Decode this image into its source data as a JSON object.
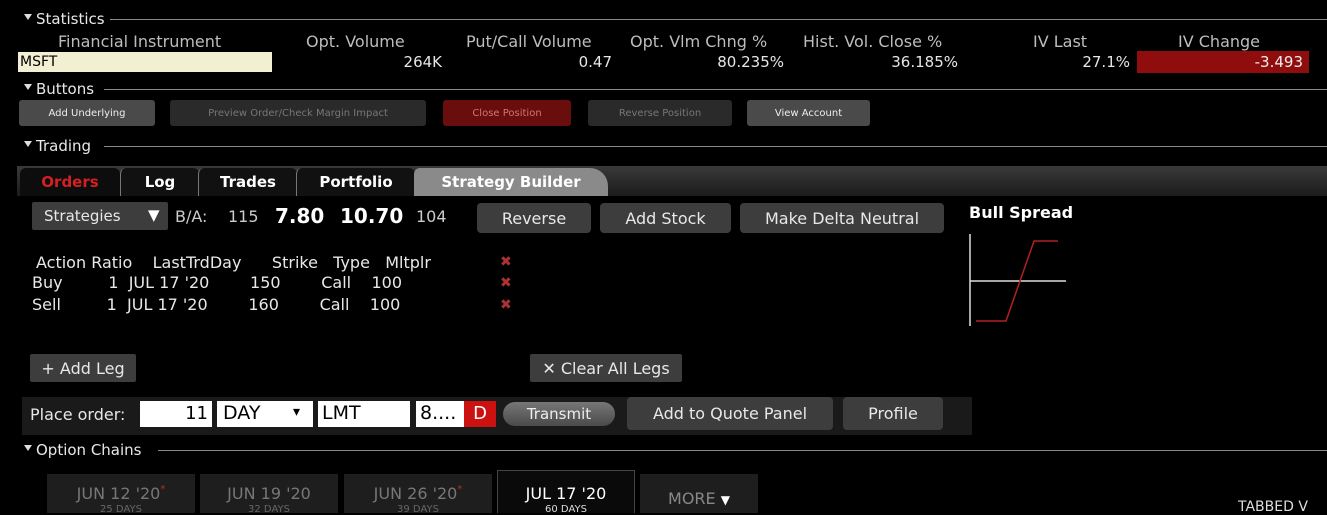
{
  "statistics": {
    "section_label": "Statistics",
    "headers": [
      "Financial Instrument",
      "Opt. Volume",
      "Put/Call Volume",
      "Opt. Vlm Chng %",
      "Hist. Vol. Close %",
      "IV Last",
      "IV Change"
    ],
    "row": {
      "instrument": "MSFT",
      "opt_volume": "264K",
      "put_call": "0.47",
      "opt_vlm_chng": "80.235%",
      "hist_vol": "36.185%",
      "iv_last": "27.1%",
      "iv_change": "-3.493"
    }
  },
  "buttons": {
    "section_label": "Buttons",
    "add_underlying": "Add Underlying",
    "preview_order": "Preview Order/Check Margin Impact",
    "close_position": "Close Position",
    "reverse_position": "Reverse Position",
    "view_account": "View Account"
  },
  "trading": {
    "section_label": "Trading",
    "tabs": [
      "Orders",
      "Log",
      "Trades",
      "Portfolio",
      "Strategy Builder"
    ],
    "strategies_label": "Strategies",
    "ba_label": "B/A:",
    "bid_size": "115",
    "bid": "7.80",
    "ask": "10.70",
    "ask_size": "104",
    "reverse_label": "Reverse",
    "add_stock_label": "Add Stock",
    "make_delta_label": "Make Delta Neutral",
    "strategy_name": "Bull Spread",
    "legs_header": "Action Ratio    LastTrdDay      Strike   Type   Mltplr",
    "legs": [
      {
        "text": "Buy         1  JUL 17 '20        150        Call    100"
      },
      {
        "text": "Sell         1  JUL 17 '20        160        Call    100"
      }
    ],
    "add_leg_label": "+ Add Leg",
    "clear_legs_label": "✕ Clear All Legs",
    "place_order_label": "Place order:",
    "quantity": "11",
    "tif": "DAY",
    "order_type": "LMT",
    "price": "8....",
    "price_flag": "D",
    "transmit_label": "Transmit",
    "add_quote_label": "Add to Quote Panel",
    "profile_label": "Profile"
  },
  "option_chains": {
    "section_label": "Option Chains",
    "expiries": [
      {
        "date": "JUN 12 '20",
        "days": "25 DAYS"
      },
      {
        "date": "JUN 19 '20",
        "days": "32 DAYS"
      },
      {
        "date": "JUN 26 '20",
        "days": "39 DAYS"
      },
      {
        "date": "JUL 17 '20",
        "days": "60 DAYS"
      }
    ],
    "more_label": "MORE",
    "tabbed_label": "TABBED V"
  },
  "colors": {
    "accent_red": "#8f0d0d",
    "orders_tab_red": "#d42020",
    "instrument_bg": "#f2efd2"
  }
}
